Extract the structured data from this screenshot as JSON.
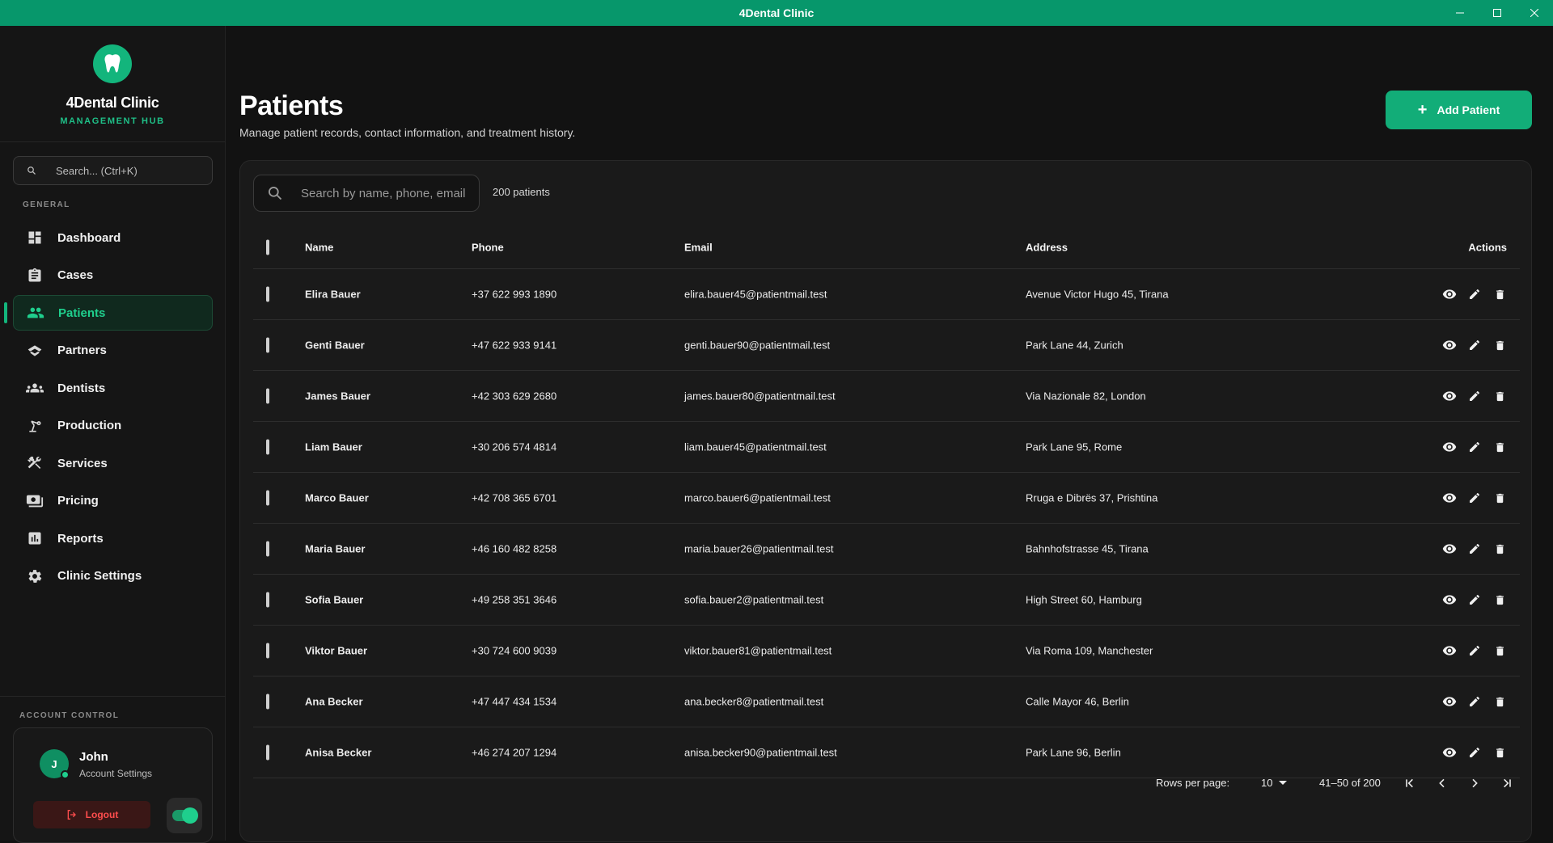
{
  "window": {
    "title": "4Dental Clinic"
  },
  "sidebar": {
    "brand_name": "4Dental Clinic",
    "brand_sub": "MANAGEMENT HUB",
    "search_placeholder": "Search... (Ctrl+K)",
    "section_general": "GENERAL",
    "items": [
      {
        "label": "Dashboard",
        "icon": "dashboard-icon"
      },
      {
        "label": "Cases",
        "icon": "clipboard-icon"
      },
      {
        "label": "Patients",
        "icon": "people-icon"
      },
      {
        "label": "Partners",
        "icon": "handshake-icon"
      },
      {
        "label": "Dentists",
        "icon": "groups-icon"
      },
      {
        "label": "Production",
        "icon": "precision-tool-icon"
      },
      {
        "label": "Services",
        "icon": "tools-icon"
      },
      {
        "label": "Pricing",
        "icon": "payments-icon"
      },
      {
        "label": "Reports",
        "icon": "bar-chart-icon"
      },
      {
        "label": "Clinic Settings",
        "icon": "gear-icon"
      }
    ],
    "active_item": "Patients",
    "section_account": "ACCOUNT CONTROL",
    "account": {
      "initial": "J",
      "name": "John",
      "subtitle": "Account Settings",
      "logout_label": "Logout"
    }
  },
  "header": {
    "title": "Patients",
    "subtitle": "Manage patient records, contact information, and treatment history.",
    "add_button": "Add Patient"
  },
  "table": {
    "search_placeholder": "Search by name, phone, email",
    "count_label": "200 patients",
    "columns": {
      "name": "Name",
      "phone": "Phone",
      "email": "Email",
      "address": "Address",
      "actions": "Actions"
    },
    "rows": [
      {
        "name": "Elira Bauer",
        "phone": "+37 622 993 1890",
        "email": "elira.bauer45@patientmail.test",
        "address": "Avenue Victor Hugo 45, Tirana"
      },
      {
        "name": "Genti Bauer",
        "phone": "+47 622 933 9141",
        "email": "genti.bauer90@patientmail.test",
        "address": "Park Lane 44, Zurich"
      },
      {
        "name": "James Bauer",
        "phone": "+42 303 629 2680",
        "email": "james.bauer80@patientmail.test",
        "address": "Via Nazionale 82, London"
      },
      {
        "name": "Liam Bauer",
        "phone": "+30 206 574 4814",
        "email": "liam.bauer45@patientmail.test",
        "address": "Park Lane 95, Rome"
      },
      {
        "name": "Marco Bauer",
        "phone": "+42 708 365 6701",
        "email": "marco.bauer6@patientmail.test",
        "address": "Rruga e Dibrës 37, Prishtina"
      },
      {
        "name": "Maria Bauer",
        "phone": "+46 160 482 8258",
        "email": "maria.bauer26@patientmail.test",
        "address": "Bahnhofstrasse 45, Tirana"
      },
      {
        "name": "Sofia Bauer",
        "phone": "+49 258 351 3646",
        "email": "sofia.bauer2@patientmail.test",
        "address": "High Street 60, Hamburg"
      },
      {
        "name": "Viktor Bauer",
        "phone": "+30 724 600 9039",
        "email": "viktor.bauer81@patientmail.test",
        "address": "Via Roma 109, Manchester"
      },
      {
        "name": "Ana Becker",
        "phone": "+47 447 434 1534",
        "email": "ana.becker8@patientmail.test",
        "address": "Calle Mayor 46, Berlin"
      },
      {
        "name": "Anisa Becker",
        "phone": "+46 274 207 1294",
        "email": "anisa.becker90@patientmail.test",
        "address": "Park Lane 96, Berlin"
      }
    ]
  },
  "pagination": {
    "rows_per_page_label": "Rows per page:",
    "rows_per_page_value": "10",
    "range_label": "41–50 of 200"
  },
  "colors": {
    "accent": "#13b57c",
    "titlebar": "#07976b",
    "danger": "#ff4d4d",
    "background": "#121212"
  }
}
